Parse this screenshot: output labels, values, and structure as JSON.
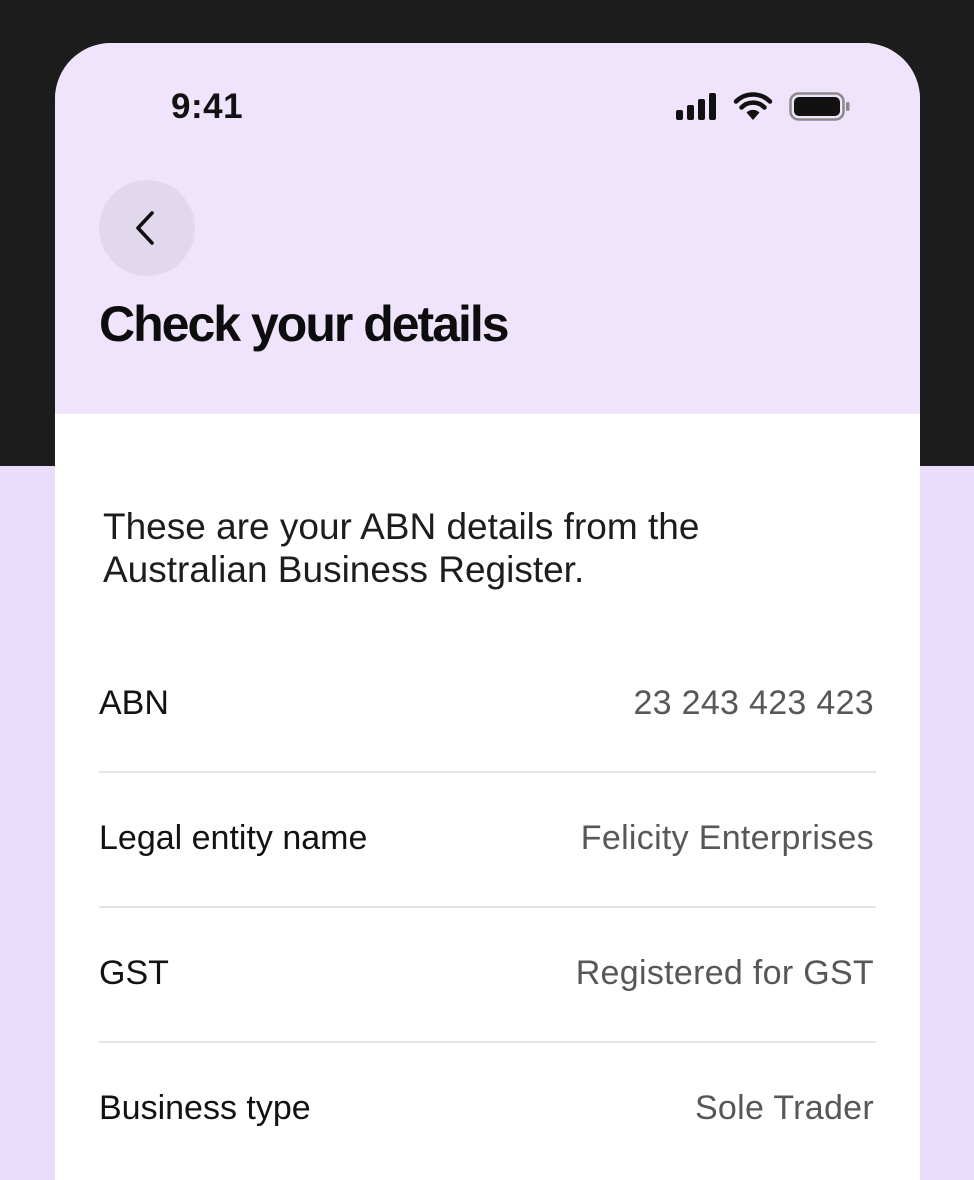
{
  "status_bar": {
    "time": "9:41",
    "icons": [
      "cellular-signal-icon",
      "wifi-icon",
      "battery-icon"
    ]
  },
  "header": {
    "back_icon": "chevron-left-icon",
    "title": "Check your details"
  },
  "main": {
    "intro": "These are your ABN details from the Australian Business Register.",
    "details": [
      {
        "label": "ABN",
        "value": "23 243 423 423"
      },
      {
        "label": "Legal entity name",
        "value": "Felicity Enterprises"
      },
      {
        "label": "GST",
        "value": "Registered for GST"
      },
      {
        "label": "Business type",
        "value": "Sole Trader"
      }
    ]
  },
  "colors": {
    "header_bg": "#efe4fc",
    "page_bg": "#eadcfd",
    "outer_dark": "#1c1c1c",
    "back_button_bg": "#e2d8ee",
    "divider": "#e4e4e6"
  }
}
